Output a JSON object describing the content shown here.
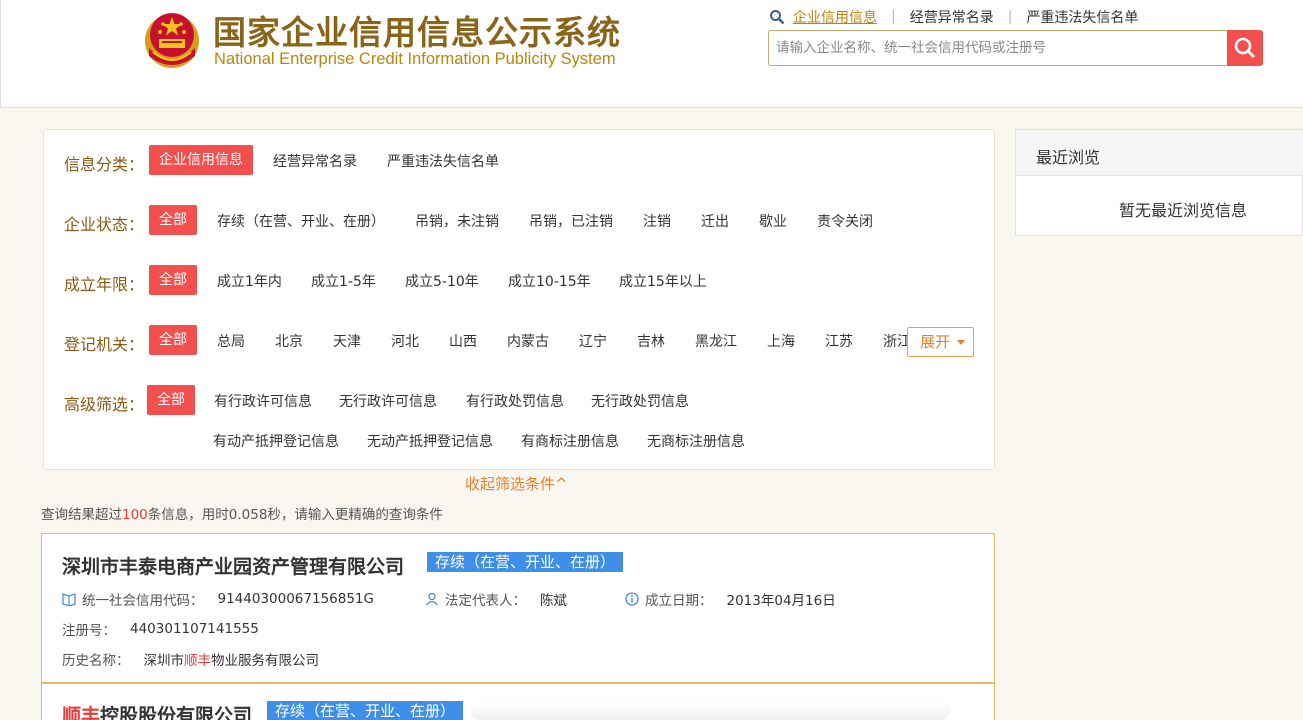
{
  "header": {
    "title": "国家企业信用信息公示系统",
    "subtitle": "National Enterprise Credit Information Publicity System",
    "links": [
      "企业信用信息",
      "经营异常名录",
      "严重违法失信名单"
    ],
    "search_placeholder": "请输入企业名称、统一社会信用代码或注册号"
  },
  "filters": {
    "category": {
      "label": "信息分类：",
      "selected": "企业信用信息",
      "options": [
        "经营异常名录",
        "严重违法失信名单"
      ]
    },
    "status": {
      "label": "企业状态：",
      "selected": "全部",
      "options": [
        "存续（在营、开业、在册）",
        "吊销，未注销",
        "吊销，已注销",
        "注销",
        "迁出",
        "歇业",
        "责令关闭"
      ]
    },
    "age": {
      "label": "成立年限：",
      "selected": "全部",
      "options": [
        "成立1年内",
        "成立1-5年",
        "成立5-10年",
        "成立10-15年",
        "成立15年以上"
      ]
    },
    "authority": {
      "label": "登记机关：",
      "selected": "全部",
      "options": [
        "总局",
        "北京",
        "天津",
        "河北",
        "山西",
        "内蒙古",
        "辽宁",
        "吉林",
        "黑龙江",
        "上海",
        "江苏",
        "浙江"
      ],
      "expand_label": "展开"
    },
    "advanced": {
      "label": "高级筛选：",
      "selected": "全部",
      "options_row1": [
        "有行政许可信息",
        "无行政许可信息",
        "有行政处罚信息",
        "无行政处罚信息"
      ],
      "options_row2": [
        "有动产抵押登记信息",
        "无动产抵押登记信息",
        "有商标注册信息",
        "无商标注册信息"
      ]
    },
    "collapse_label": "收起筛选条件^"
  },
  "query": {
    "prefix": "查询结果超过",
    "count": "100",
    "suffix": "条信息，用时0.058秒，请输入更精确的查询条件"
  },
  "results": [
    {
      "name": "深圳市丰泰电商产业园资产管理有限公司",
      "status": "存续（在营、开业、在册）",
      "credit_code_label": "统一社会信用代码：",
      "credit_code": "91440300067156851G",
      "legal_rep_label": "法定代表人：",
      "legal_rep": "陈斌",
      "date_label": "成立日期：",
      "date": "2013年04月16日",
      "reg_no_label": "注册号：",
      "reg_no": "440301107141555",
      "history_label": "历史名称：",
      "history_pre": "深圳市",
      "history_hl": "顺丰",
      "history_post": "物业服务有限公司"
    },
    {
      "name_hl": "顺丰",
      "name_rest": "控股股份有限公司",
      "status": "存续（在营、开业、在册）"
    }
  ],
  "recent": {
    "title": "最近浏览",
    "empty": "暂无最近浏览信息"
  },
  "colors": {
    "accent_red": "#f2504f",
    "brown": "#8a5a14",
    "gold": "#b8860b",
    "orange": "#e8802a",
    "badge_blue": "#3f8ee8"
  }
}
